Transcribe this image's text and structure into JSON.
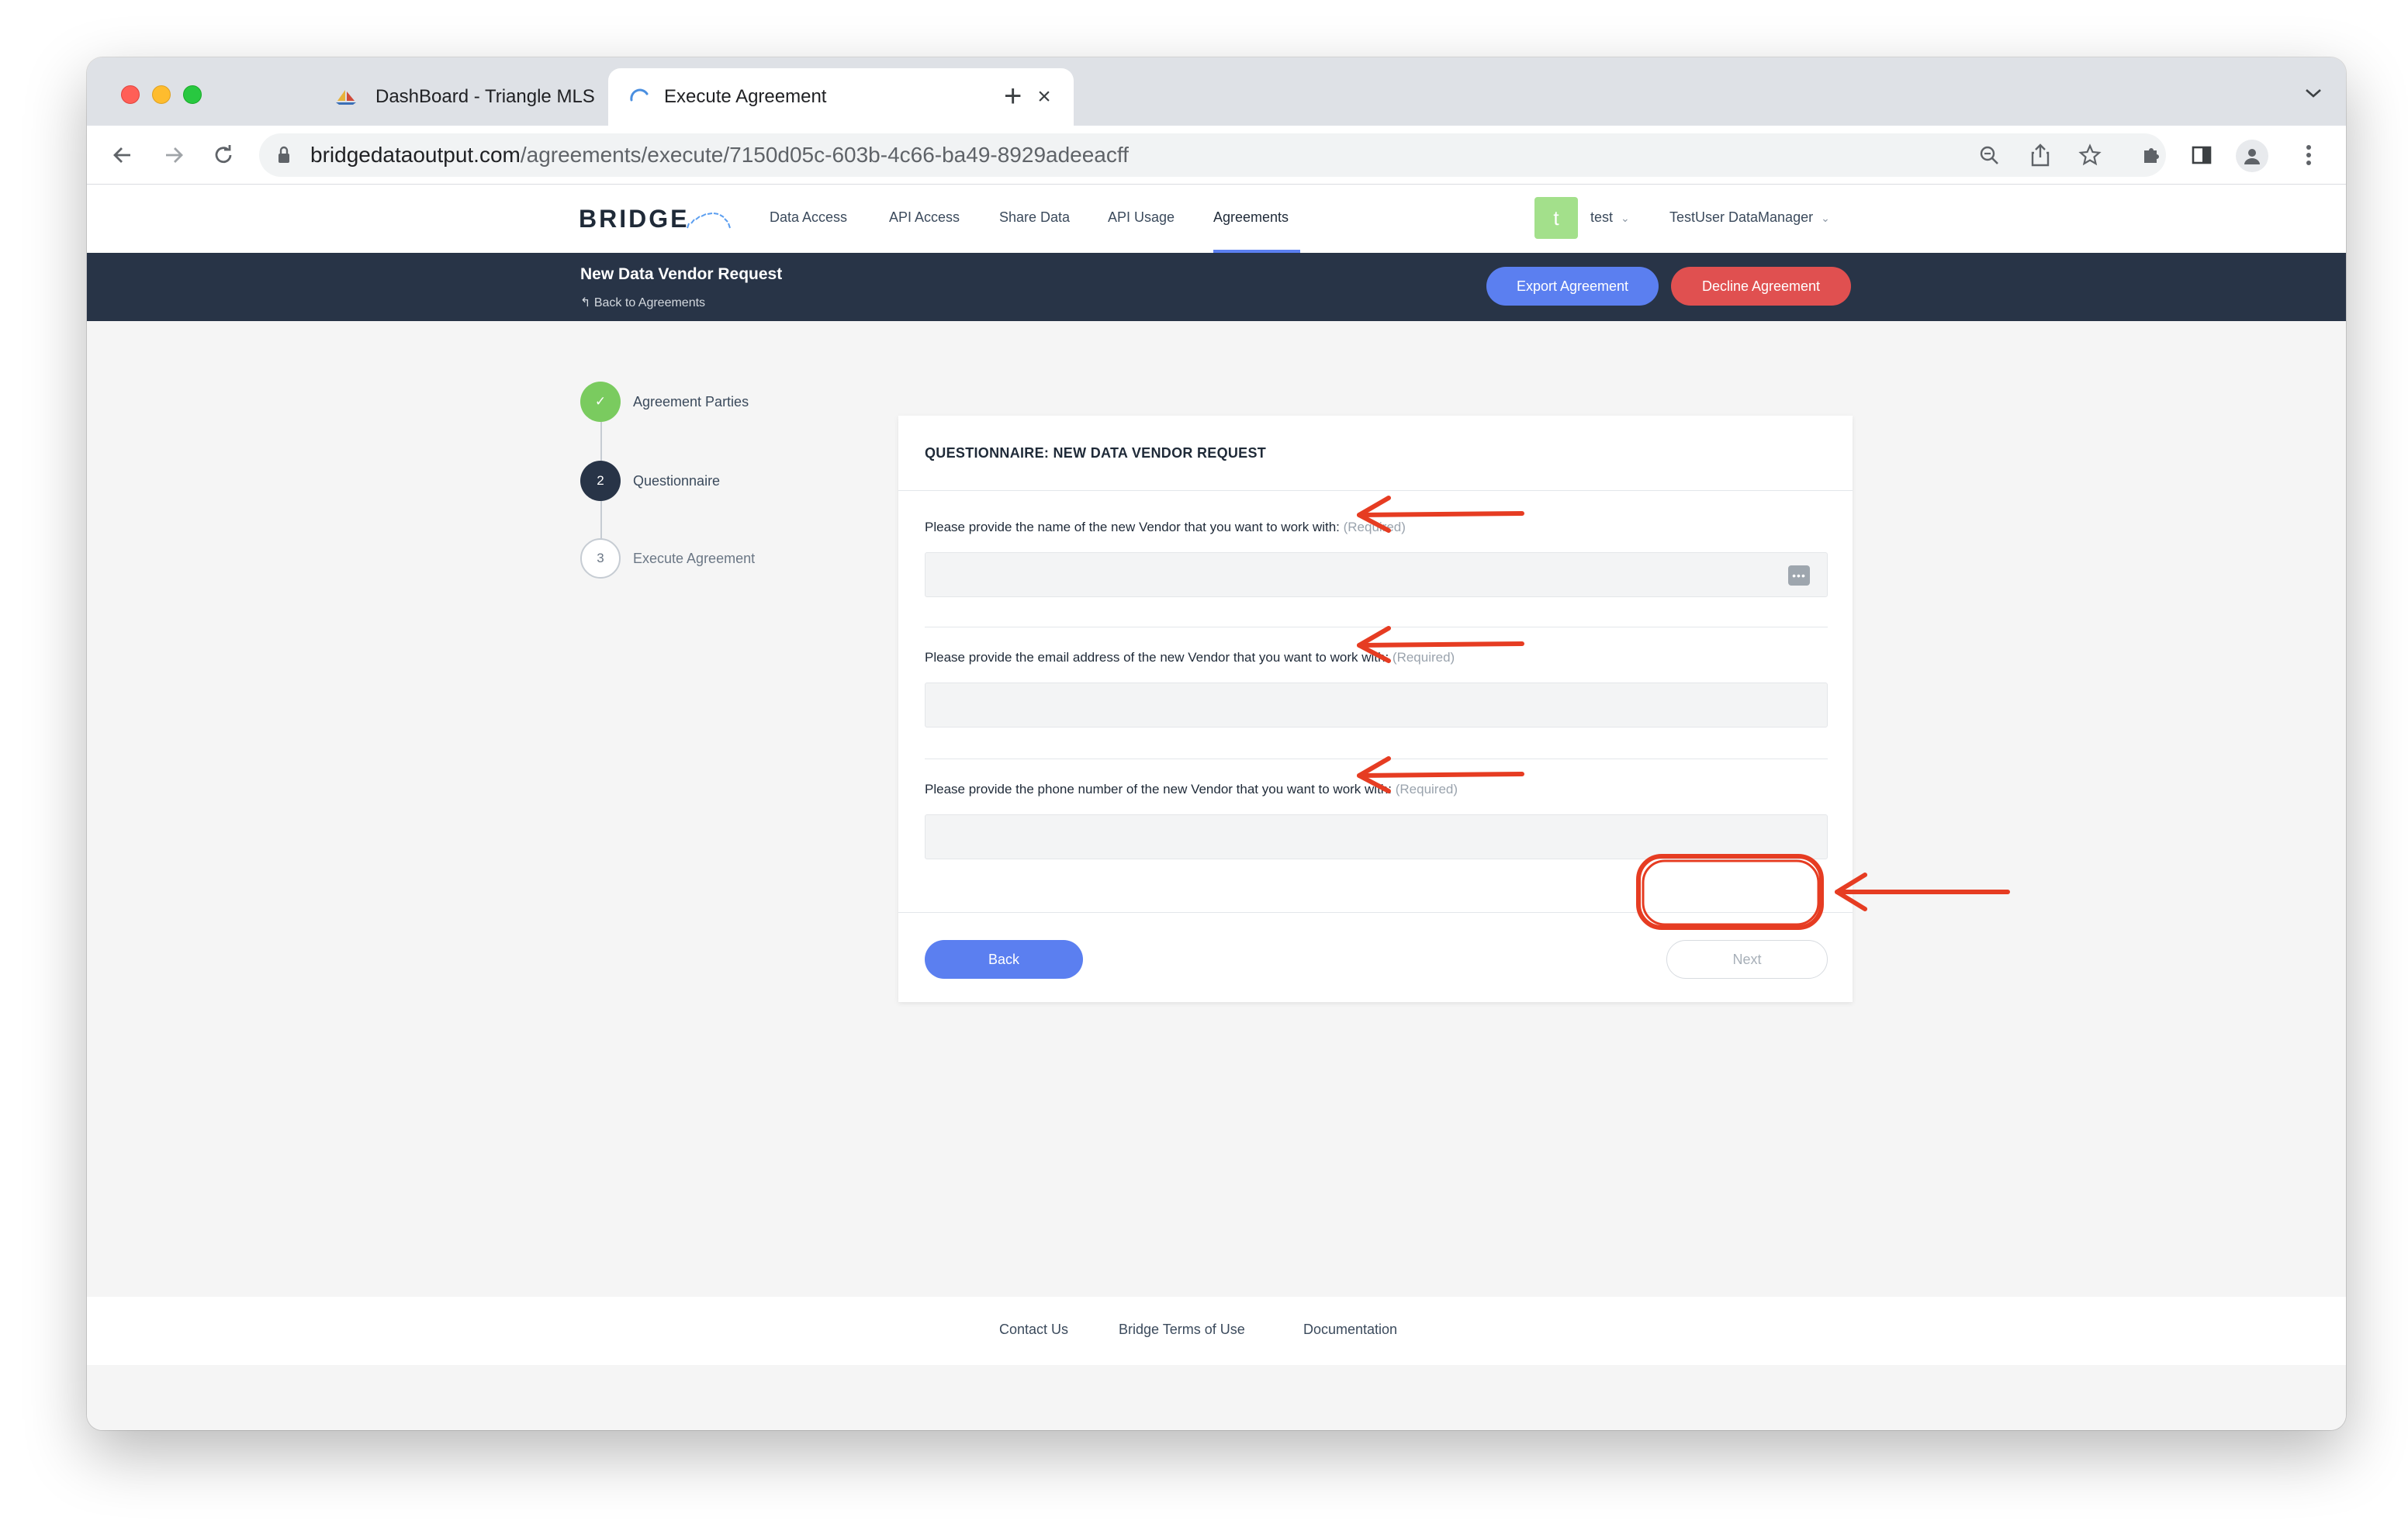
{
  "browser": {
    "tabs": [
      {
        "title": "DashBoard - Triangle MLS",
        "icon": "sailboat-favicon"
      },
      {
        "title": "Execute Agreement",
        "icon": "loading-spinner-icon"
      }
    ],
    "url_host": "bridgedataoutput.com",
    "url_path": "/agreements/execute/7150d05c-603b-4c66-ba49-8929adeeacff"
  },
  "site": {
    "logo": "BRIDGE",
    "nav": [
      "Data Access",
      "API Access",
      "Share Data",
      "API Usage",
      "Agreements"
    ],
    "active_nav": "Agreements",
    "user_initial": "t",
    "user_name": "test",
    "org_name": "TestUser DataManager"
  },
  "subheader": {
    "title": "New Data Vendor Request",
    "back_link": "Back to Agreements",
    "export_label": "Export Agreement",
    "decline_label": "Decline Agreement"
  },
  "steps": [
    {
      "marker": "✓",
      "label": "Agreement Parties",
      "state": "done"
    },
    {
      "marker": "2",
      "label": "Questionnaire",
      "state": "current"
    },
    {
      "marker": "3",
      "label": "Execute Agreement",
      "state": "pending"
    }
  ],
  "card": {
    "title": "QUESTIONNAIRE: NEW DATA VENDOR REQUEST",
    "questions": [
      {
        "label": "Please provide the name of the new Vendor that you want to work with:",
        "required": "(Required)",
        "value": ""
      },
      {
        "label": "Please provide the email address of the new Vendor that you want to work with:",
        "required": "(Required)",
        "value": ""
      },
      {
        "label": "Please provide the phone number of the new Vendor that you want to work with:",
        "required": "(Required)",
        "value": ""
      }
    ],
    "back_label": "Back",
    "next_label": "Next",
    "input_icon": "dots-autofill-icon"
  },
  "footer": {
    "links": [
      "Contact Us",
      "Bridge Terms of Use",
      "Documentation"
    ]
  },
  "colors": {
    "accent": "#5b7ff0",
    "danger": "#e05050",
    "header_dark": "#283447",
    "step_done": "#7acb5f",
    "annotation": "#e63c22"
  }
}
